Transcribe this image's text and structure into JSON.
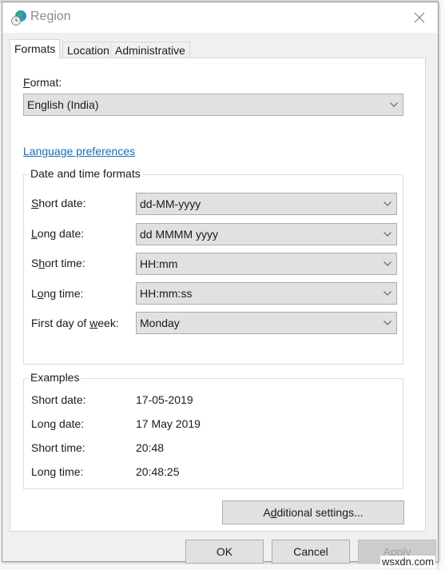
{
  "window": {
    "title": "Region",
    "icon": "globe-clock-icon",
    "close_icon": "close-icon"
  },
  "tabs": [
    {
      "label": "Formats",
      "active": true
    },
    {
      "label": "Location",
      "active": false
    },
    {
      "label": "Administrative",
      "active": false
    }
  ],
  "format": {
    "label_accel": "F",
    "label_rest": "ormat:",
    "value": "English (India)"
  },
  "language_link": "Language preferences",
  "date_time_formats": {
    "title": "Date and time formats",
    "rows": [
      {
        "label_pre": "",
        "accel": "S",
        "label_post": "hort date:",
        "value": "dd-MM-yyyy"
      },
      {
        "label_pre": "",
        "accel": "L",
        "label_post": "ong date:",
        "value": "dd MMMM yyyy"
      },
      {
        "label_pre": "S",
        "accel": "h",
        "label_post": "ort time:",
        "value": "HH:mm"
      },
      {
        "label_pre": "L",
        "accel": "o",
        "label_post": "ng time:",
        "value": "HH:mm:ss"
      },
      {
        "label_pre": "First day of ",
        "accel": "w",
        "label_post": "eek:",
        "value": "Monday"
      }
    ]
  },
  "examples": {
    "title": "Examples",
    "rows": [
      {
        "label": "Short date:",
        "value": "17-05-2019"
      },
      {
        "label": "Long date:",
        "value": "17 May 2019"
      },
      {
        "label": "Short time:",
        "value": "20:48"
      },
      {
        "label": "Long time:",
        "value": "20:48:25"
      }
    ]
  },
  "additional_settings": {
    "pre": "A",
    "accel": "d",
    "post": "ditional settings..."
  },
  "buttons": {
    "ok": "OK",
    "cancel": "Cancel",
    "apply_accel": "A",
    "apply_rest": "pply"
  },
  "watermark": "wsxdn.com"
}
